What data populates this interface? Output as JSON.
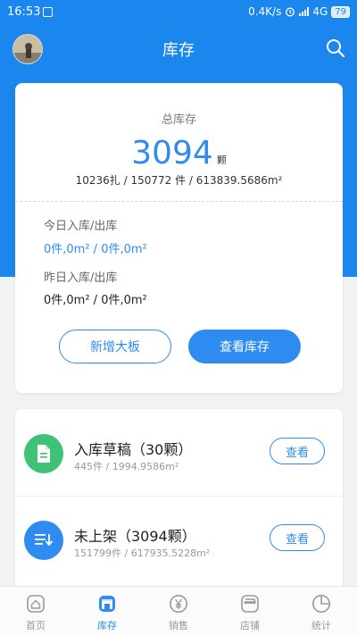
{
  "status_bar": {
    "time": "16:53",
    "net_speed": "0.4K/s",
    "network": "4G",
    "battery": "79"
  },
  "header": {
    "title": "库存"
  },
  "summary": {
    "label": "总库存",
    "total": "3094",
    "unit": "颗",
    "detail": "10236扎 / 150772 件 / 613839.5686m²",
    "today_label": "今日入库/出库",
    "today_value": "0件,0m² / 0件,0m²",
    "yesterday_label": "昨日入库/出库",
    "yesterday_value": "0件,0m² / 0件,0m²",
    "add_button": "新增大板",
    "view_button": "查看库存"
  },
  "list": [
    {
      "title": "入库草稿（30颗）",
      "sub": "445件 / 1994.9586m²",
      "button": "查看",
      "icon": "document-icon",
      "color": "#3ec275"
    },
    {
      "title": "未上架（3094颗）",
      "sub": "151799件 / 617935.5228m²",
      "button": "查看",
      "icon": "list-download-icon",
      "color": "#2e8cf0"
    }
  ],
  "tabs": [
    {
      "label": "首页",
      "icon": "home-icon"
    },
    {
      "label": "库存",
      "icon": "store-icon"
    },
    {
      "label": "销售",
      "icon": "yen-icon"
    },
    {
      "label": "店铺",
      "icon": "shop-icon"
    },
    {
      "label": "统计",
      "icon": "pie-chart-icon"
    }
  ],
  "colors": {
    "brand": "#1b86ee",
    "accent": "#2e8cf0",
    "green": "#3ec275"
  }
}
